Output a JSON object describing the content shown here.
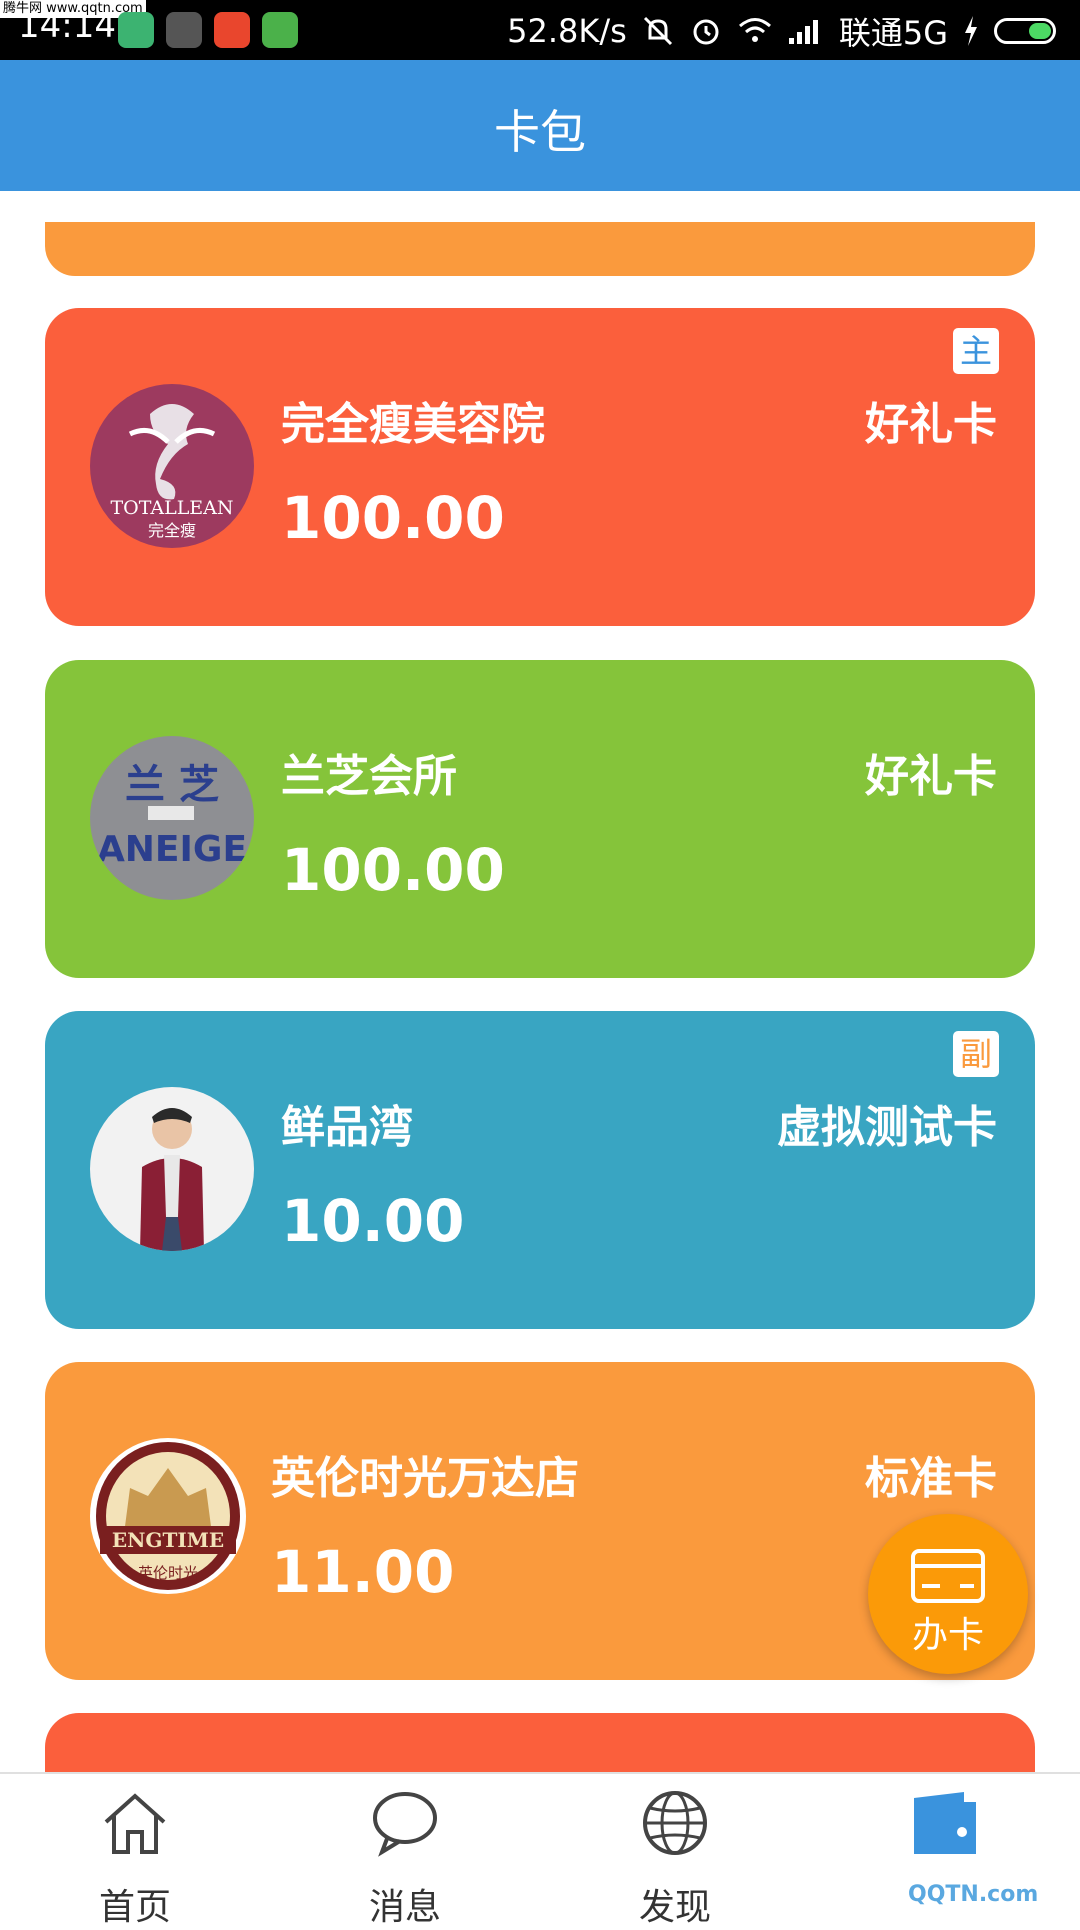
{
  "status_bar": {
    "watermark": "腾牛网 www.qqtn.com",
    "time": "14:14",
    "network_speed": "52.8K/s",
    "carrier": "联通5G"
  },
  "header": {
    "title": "卡包"
  },
  "cards": [
    {
      "store": "完全瘦美容院",
      "amount": "100.00",
      "type": "好礼卡",
      "badge": "主",
      "color": "#fb5f3c"
    },
    {
      "store": "兰芝会所",
      "amount": "100.00",
      "type": "好礼卡",
      "badge": "",
      "color": "#85c43a"
    },
    {
      "store": "鲜品湾",
      "amount": "10.00",
      "type": "虚拟测试卡",
      "badge": "副",
      "color": "#39a5c2"
    },
    {
      "store": "英伦时光万达店",
      "amount": "11.00",
      "type": "标准卡",
      "badge": "",
      "color": "#fa9a3d"
    }
  ],
  "logos": {
    "totallean": "TOTALLEAN",
    "totallean_cn": "完全瘦",
    "laneige_cn": "兰 芝",
    "laneige": "ANEIGE",
    "engtime": "ENGTIME",
    "engtime_cn": "英伦时光"
  },
  "fab": {
    "label": "办卡"
  },
  "bottom_nav": [
    {
      "label": "首页",
      "icon": "home-icon"
    },
    {
      "label": "消息",
      "icon": "chat-icon"
    },
    {
      "label": "发现",
      "icon": "globe-icon"
    },
    {
      "label": "",
      "icon": "wallet-icon"
    }
  ],
  "corner_watermark": "QQTN.com"
}
